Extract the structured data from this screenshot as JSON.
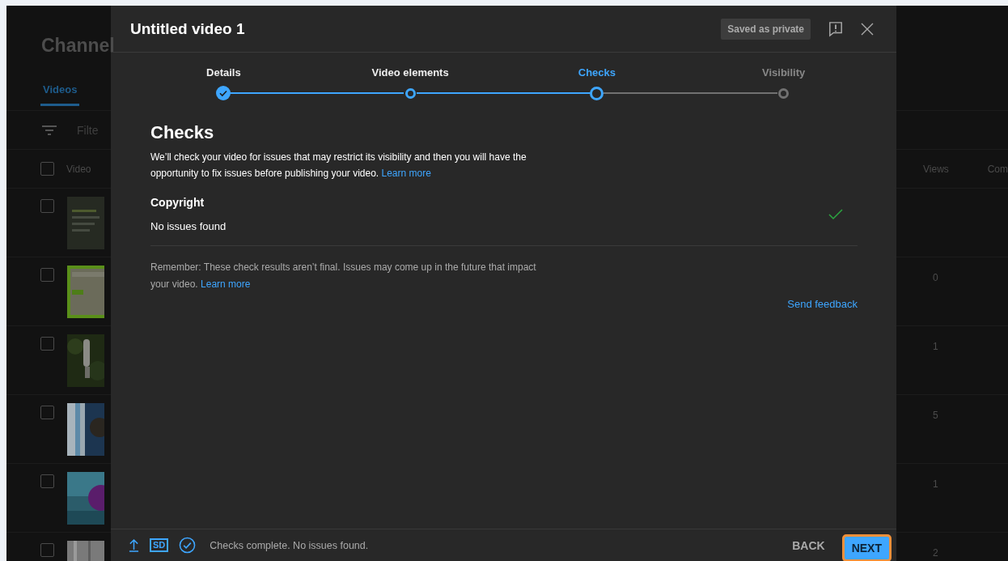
{
  "background_page": {
    "title": "Channel",
    "tabs": [
      {
        "label": "Videos",
        "selected": true
      }
    ],
    "filter": {
      "placeholder": "Filte"
    },
    "table": {
      "columns": [
        "Video",
        "Views",
        "Com"
      ],
      "header_checked": false,
      "rows": [
        {
          "checked": false
        },
        {
          "checked": false,
          "views": "0"
        },
        {
          "checked": false,
          "views": "1"
        },
        {
          "checked": false,
          "views": "5"
        },
        {
          "checked": false,
          "views": "1"
        },
        {
          "checked": false,
          "views": "2"
        }
      ]
    }
  },
  "dialog": {
    "title": "Untitled video 1",
    "save_status": "Saved as private",
    "steps": [
      {
        "label": "Details",
        "reached": true,
        "completed": true,
        "selected": false
      },
      {
        "label": "Video elements",
        "reached": true,
        "completed": false,
        "selected": false
      },
      {
        "label": "Checks",
        "reached": true,
        "completed": false,
        "selected": true
      },
      {
        "label": "Visibility",
        "reached": false,
        "completed": false,
        "selected": false
      }
    ],
    "heading": "Checks",
    "description": "We’ll check your video for issues that may restrict its visibility and then you will have the opportunity to fix issues before publishing your video.",
    "description_link": "Learn more",
    "checks": [
      {
        "title": "Copyright",
        "result": "No issues found",
        "passed": true
      }
    ],
    "note": "Remember: These check results aren’t final. Issues may come up in the future that impact your video.",
    "note_link": "Learn more",
    "feedback_link": "Send feedback",
    "footer": {
      "status": "Checks complete. No issues found.",
      "quality": "SD",
      "back": "BACK",
      "next": {
        "label": "NEXT",
        "highlighted": true
      }
    }
  }
}
